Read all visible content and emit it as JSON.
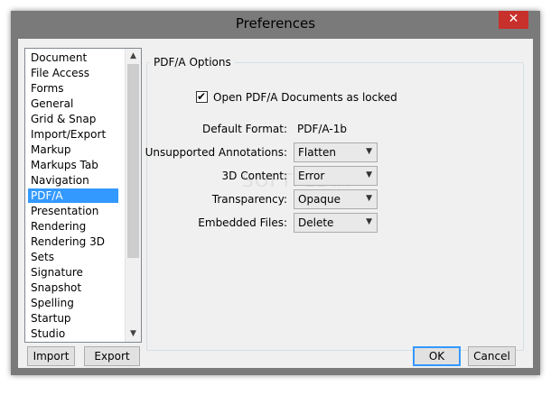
{
  "window": {
    "title": "Preferences",
    "close_glyph": "✕"
  },
  "sidebar": {
    "items": [
      {
        "label": "Document"
      },
      {
        "label": "File Access"
      },
      {
        "label": "Forms"
      },
      {
        "label": "General"
      },
      {
        "label": "Grid & Snap"
      },
      {
        "label": "Import/Export"
      },
      {
        "label": "Markup"
      },
      {
        "label": "Markups Tab"
      },
      {
        "label": "Navigation"
      },
      {
        "label": "PDF/A"
      },
      {
        "label": "Presentation"
      },
      {
        "label": "Rendering"
      },
      {
        "label": "Rendering 3D"
      },
      {
        "label": "Sets"
      },
      {
        "label": "Signature"
      },
      {
        "label": "Snapshot"
      },
      {
        "label": "Spelling"
      },
      {
        "label": "Startup"
      },
      {
        "label": "Studio"
      }
    ],
    "selected": "PDF/A",
    "selection_color": "#3399ff"
  },
  "options": {
    "group_title": "PDF/A Options",
    "open_locked": {
      "label": "Open PDF/A Documents as locked",
      "checked": true
    },
    "default_format": {
      "label": "Default Format:",
      "value": "PDF/A-1b"
    },
    "unsupported_annotations": {
      "label": "Unsupported Annotations:",
      "value": "Flatten"
    },
    "content_3d": {
      "label": "3D Content:",
      "value": "Error"
    },
    "transparency": {
      "label": "Transparency:",
      "value": "Opaque"
    },
    "embedded_files": {
      "label": "Embedded Files:",
      "value": "Delete"
    }
  },
  "buttons": {
    "import": "Import",
    "export": "Export",
    "ok": "OK",
    "cancel": "Cancel"
  },
  "watermark": "SOFTPEDIA"
}
